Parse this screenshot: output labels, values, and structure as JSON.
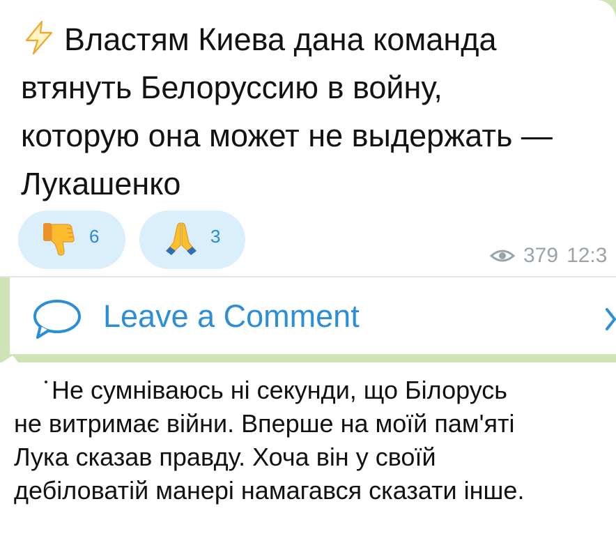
{
  "post": {
    "headline_lines": [
      "Властям Киева дана команда",
      "втянуть Белоруссию в войну,",
      "которую она может не выдержать —",
      "Лукашенко"
    ],
    "headline_icon": "lightning-bolt-icon",
    "reactions": [
      {
        "icon": "thumbs-down-emoji",
        "count": "6"
      },
      {
        "icon": "folded-hands-emoji",
        "count": "3"
      }
    ],
    "views": "379",
    "time": "12:3"
  },
  "comment_bar": {
    "label": "Leave a Comment",
    "icon": "comment-bubble-icon",
    "chevron": "chevron-right-icon"
  },
  "caption": {
    "lines": [
      "Не сумніваюсь ні секунди, що Білорусь",
      "не витримає війни. Вперше на моїй пам'яті",
      "Лука сказав правду. Хоча він у своїй",
      "дебіловатій манері намагався сказати інше."
    ]
  },
  "colors": {
    "accent": "#2b8ed6",
    "reaction_bg": "#dbeefb",
    "chat_bg": "#cfe3b6",
    "meta": "#9aa3aa"
  }
}
